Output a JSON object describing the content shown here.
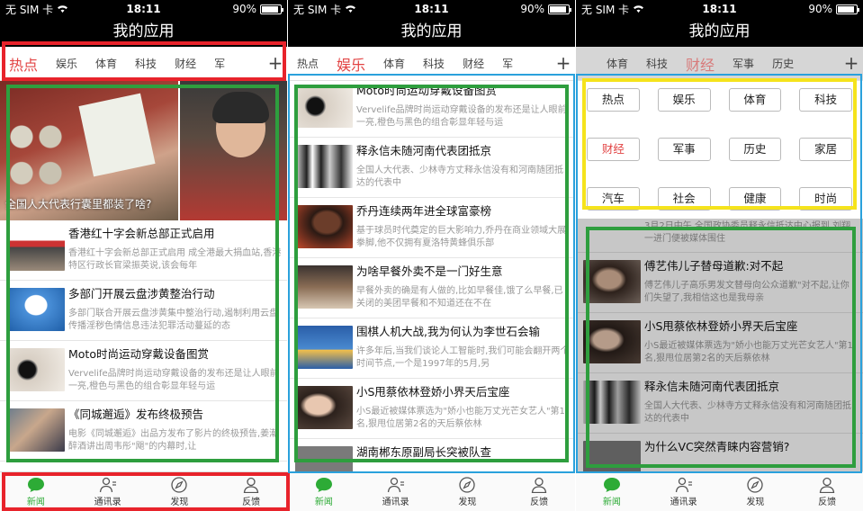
{
  "statusbar": {
    "carrier": "无 SIM 卡",
    "time": "18:11",
    "battery": "90%",
    "battery_level": 0.9
  },
  "app_title": "我的应用",
  "phone1": {
    "tabs": [
      "热点",
      "娱乐",
      "体育",
      "科技",
      "财经",
      "军"
    ],
    "active_tab": 0,
    "hero_caption": "全国人大代表行囊里都装了啥?",
    "news": [
      {
        "title": "香港红十字会新总部正式启用",
        "summary": "香港红十字会新总部正式启用 成全港最大捐血站,香港特区行政长官梁振英说,该会每年"
      },
      {
        "title": "多部门开展云盘涉黄整治行动",
        "summary": "多部门联合开展云盘涉黄集中整治行动,遏制利用云盘传播淫秽色情信息违法犯罪活动蔓延的态"
      },
      {
        "title": "Moto时尚运动穿戴设备图赏",
        "summary": "Vervelife品牌时尚运动穿戴设备的发布还是让人眼前一亮,橙色与黑色的组合彰显年轻与运"
      },
      {
        "title": "《同城邂逅》发布终极预告",
        "summary": "电影《同城邂逅》出品方发布了影片的终极预告,姜潮醉酒讲出周韦彤\"飓\"的内幕时,让"
      }
    ]
  },
  "phone2": {
    "tabs": [
      "热点",
      "娱乐",
      "体育",
      "科技",
      "财经",
      "军"
    ],
    "active_tab": 1,
    "news": [
      {
        "title": "Moto时尚运动穿戴设备图赏",
        "summary": "Vervelife品牌时尚运动穿戴设备的发布还是让人眼前一亮,橙色与黑色的组合彰显年轻与运"
      },
      {
        "title": "释永信未随河南代表团抵京",
        "summary": "全国人大代表、少林寺方丈释永信没有和河南随团抵达的代表中"
      },
      {
        "title": "乔丹连续两年进全球富豪榜",
        "summary": "基于球员时代奠定的巨大影响力,乔丹在商业领域大展拳脚,他不仅拥有夏洛特黄蜂俱乐部"
      },
      {
        "title": "为啥早餐外卖不是一门好生意",
        "summary": "早餐外卖的确是有人做的,比如早餐佳,饿了么早餐,已关闭的美团早餐和不知道还在不在"
      },
      {
        "title": "围棋人机大战,我为何认为李世石会输",
        "summary": "许多年后,当我们谈论人工智能时,我们可能会翻开两个时间节点,一个是1997年的5月,另"
      },
      {
        "title": "小S甩蔡依林登娇小界天后宝座",
        "summary": "小S最近被媒体票选为\"娇小也能万丈光芒女艺人\"第1名,狠甩位居第2名的天后蔡依林"
      },
      {
        "title": "湖南郴东原副局长突被队查",
        "summary": ""
      }
    ]
  },
  "phone3": {
    "tabs": [
      "体育",
      "科技",
      "财经",
      "军事",
      "历史"
    ],
    "active_tab": 2,
    "categories": [
      "热点",
      "娱乐",
      "体育",
      "科技",
      "财经",
      "军事",
      "历史",
      "家居",
      "汽车",
      "社会",
      "健康",
      "时尚"
    ],
    "active_category": 4,
    "partial_summary": "3月2日中午,全国政协委员释永信抵达中心报到,刘翔一进门便被媒体围住",
    "news": [
      {
        "title": "傅艺伟儿子替母道歉:对不起",
        "summary": "傅艺伟儿子高乐男发文替母向公众道歉\"对不起,让你们失望了,我相信这也是我母亲"
      },
      {
        "title": "小S甩蔡依林登娇小界天后宝座",
        "summary": "小S最近被媒体票选为\"娇小也能万丈光芒女艺人\"第1名,狠甩位居第2名的天后蔡依林"
      },
      {
        "title": "释永信未随河南代表团抵京",
        "summary": "全国人大代表、少林寺方丈释永信没有和河南随团抵达的代表中"
      },
      {
        "title": "为什么VC突然青睐内容营销?",
        "summary": ""
      }
    ]
  },
  "tabbar": [
    {
      "label": "新闻",
      "icon": "chat-bubble-icon",
      "active": true
    },
    {
      "label": "通讯录",
      "icon": "contacts-icon",
      "active": false
    },
    {
      "label": "发现",
      "icon": "compass-icon",
      "active": false
    },
    {
      "label": "反馈",
      "icon": "person-icon",
      "active": false
    }
  ],
  "colors": {
    "accent_red": "#e24444",
    "active_green": "#2dab36",
    "hl_red": "#e8232b",
    "hl_green": "#2e9e3e",
    "hl_blue": "#2aa1dc",
    "hl_yellow": "#f5e31c"
  }
}
